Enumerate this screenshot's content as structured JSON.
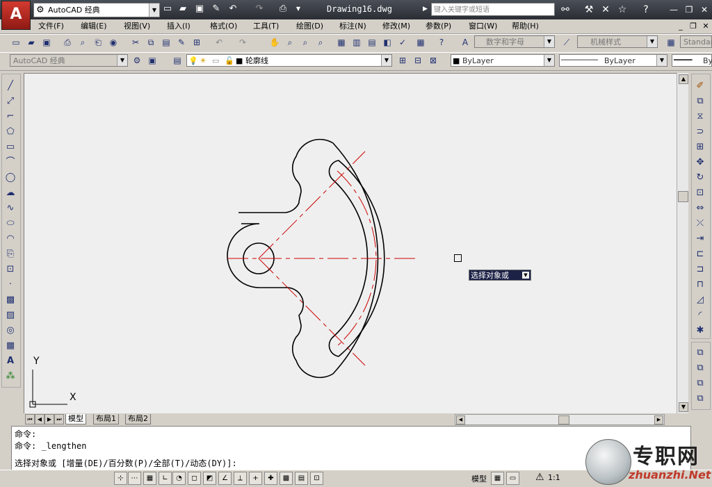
{
  "app": {
    "workspace": "AutoCAD 经典",
    "doc_title": "Drawing16.dwg",
    "search_placeholder": "键入关键字或短语"
  },
  "menu": [
    "文件(F)",
    "编辑(E)",
    "视图(V)",
    "插入(I)",
    "格式(O)",
    "工具(T)",
    "绘图(D)",
    "标注(N)",
    "修改(M)",
    "参数(P)",
    "窗口(W)",
    "帮助(H)"
  ],
  "toolbar1": {
    "text_style": "数字和字母",
    "dim_style": "机械样式",
    "table_style": "Standar"
  },
  "toolbar2": {
    "workspace": "AutoCAD 经典",
    "layer": "轮廓线",
    "color": "ByLayer",
    "linetype": "ByLayer",
    "lineweight": "By"
  },
  "ucs": {
    "y": "Y",
    "x": "X"
  },
  "tabs": [
    "模型",
    "布局1",
    "布局2"
  ],
  "tooltip": "选择对象或",
  "command": {
    "line1": "命令:",
    "line2": "命令: _lengthen",
    "line3": "选择对象或 [增量(DE)/百分数(P)/全部(T)/动态(DY)]:"
  },
  "status": {
    "model": "模型",
    "scale": "1:1"
  },
  "watermark": {
    "cn": "专职网",
    "en": "zhuanzhi.Net"
  },
  "colors": {
    "titlebar": "#2f333a",
    "canvas": "#efefef",
    "centerline": "#cc0000",
    "outline": "#000000",
    "tooltip_bg": "#1c2146"
  }
}
